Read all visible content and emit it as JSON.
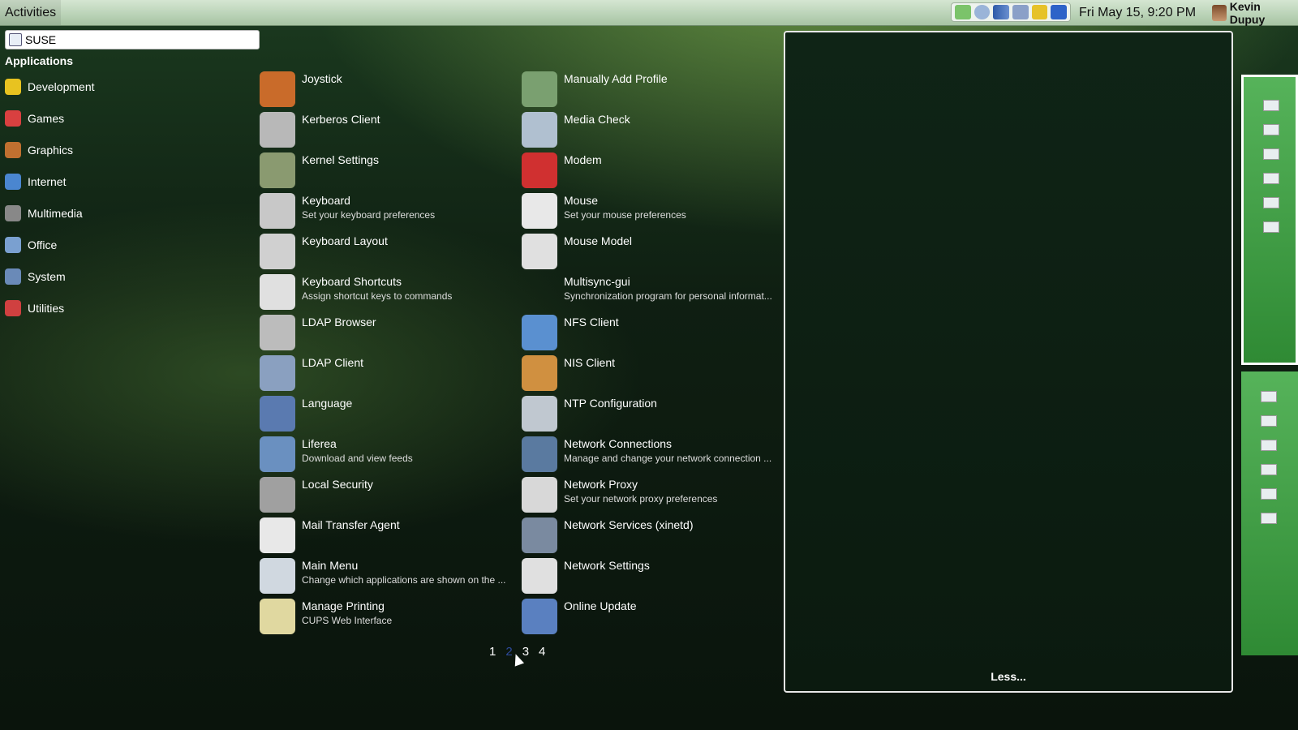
{
  "topbar": {
    "activities": "Activities",
    "clock": "Fri May 15,  9:20 PM",
    "user": "Kevin Dupuy",
    "tray_icons": [
      "network-icon",
      "web-icon",
      "signal-icon",
      "battery-icon",
      "display-icon",
      "bluetooth-icon"
    ]
  },
  "search": {
    "value": "SUSE"
  },
  "sidebar": {
    "heading": "Applications",
    "items": [
      {
        "label": "Development",
        "color": "#e8c320"
      },
      {
        "label": "Games",
        "color": "#d94040"
      },
      {
        "label": "Graphics",
        "color": "#c07030"
      },
      {
        "label": "Internet",
        "color": "#4a86d0"
      },
      {
        "label": "Multimedia",
        "color": "#888888"
      },
      {
        "label": "Office",
        "color": "#7aa0d0"
      },
      {
        "label": "System",
        "color": "#6a8ab8"
      },
      {
        "label": "Utilities",
        "color": "#d04040"
      }
    ]
  },
  "apps": {
    "left": [
      {
        "name": "Joystick",
        "desc": "",
        "color": "#c96b2a"
      },
      {
        "name": "Kerberos Client",
        "desc": "",
        "color": "#b8b8b8"
      },
      {
        "name": "Kernel Settings",
        "desc": "",
        "color": "#8a9a70"
      },
      {
        "name": "Keyboard",
        "desc": "Set your keyboard preferences",
        "color": "#c8c8c8"
      },
      {
        "name": "Keyboard Layout",
        "desc": "",
        "color": "#d0d0d0"
      },
      {
        "name": "Keyboard Shortcuts",
        "desc": "Assign shortcut keys to commands",
        "color": "#e0e0e0"
      },
      {
        "name": "LDAP Browser",
        "desc": "",
        "color": "#bcbcbc"
      },
      {
        "name": "LDAP Client",
        "desc": "",
        "color": "#8aa0c0"
      },
      {
        "name": "Language",
        "desc": "",
        "color": "#5a7ab0"
      },
      {
        "name": "Liferea",
        "desc": "Download and view feeds",
        "color": "#6a90c0"
      },
      {
        "name": "Local Security",
        "desc": "",
        "color": "#a0a0a0"
      },
      {
        "name": "Mail Transfer Agent",
        "desc": "",
        "color": "#e8e8e8"
      },
      {
        "name": "Main Menu",
        "desc": "Change which applications are shown on the ...",
        "color": "#d0d8e0"
      },
      {
        "name": "Manage Printing",
        "desc": "CUPS Web Interface",
        "color": "#e0d8a0"
      }
    ],
    "right": [
      {
        "name": "Manually Add Profile",
        "desc": "",
        "color": "#7aa070"
      },
      {
        "name": "Media Check",
        "desc": "",
        "color": "#b0c0d0"
      },
      {
        "name": "Modem",
        "desc": "",
        "color": "#d03030"
      },
      {
        "name": "Mouse",
        "desc": "Set your mouse preferences",
        "color": "#e8e8e8"
      },
      {
        "name": "Mouse Model",
        "desc": "",
        "color": "#e0e0e0"
      },
      {
        "name": "Multisync-gui",
        "desc": "Synchronization program for personal informat...",
        "color": ""
      },
      {
        "name": "NFS Client",
        "desc": "",
        "color": "#5a90d0"
      },
      {
        "name": "NIS Client",
        "desc": "",
        "color": "#d09040"
      },
      {
        "name": "NTP Configuration",
        "desc": "",
        "color": "#c0c8d0"
      },
      {
        "name": "Network Connections",
        "desc": "Manage and change your network connection ...",
        "color": "#5a7aa0"
      },
      {
        "name": "Network Proxy",
        "desc": "Set your network proxy preferences",
        "color": "#d8d8d8"
      },
      {
        "name": "Network Services (xinetd)",
        "desc": "",
        "color": "#7a8aa0"
      },
      {
        "name": "Network Settings",
        "desc": "",
        "color": "#e0e0e0"
      },
      {
        "name": "Online Update",
        "desc": "",
        "color": "#5a80c0"
      }
    ]
  },
  "pager": {
    "pages": [
      "1",
      "2",
      "3",
      "4"
    ],
    "current": "2"
  },
  "panel": {
    "less_label": "Less..."
  }
}
